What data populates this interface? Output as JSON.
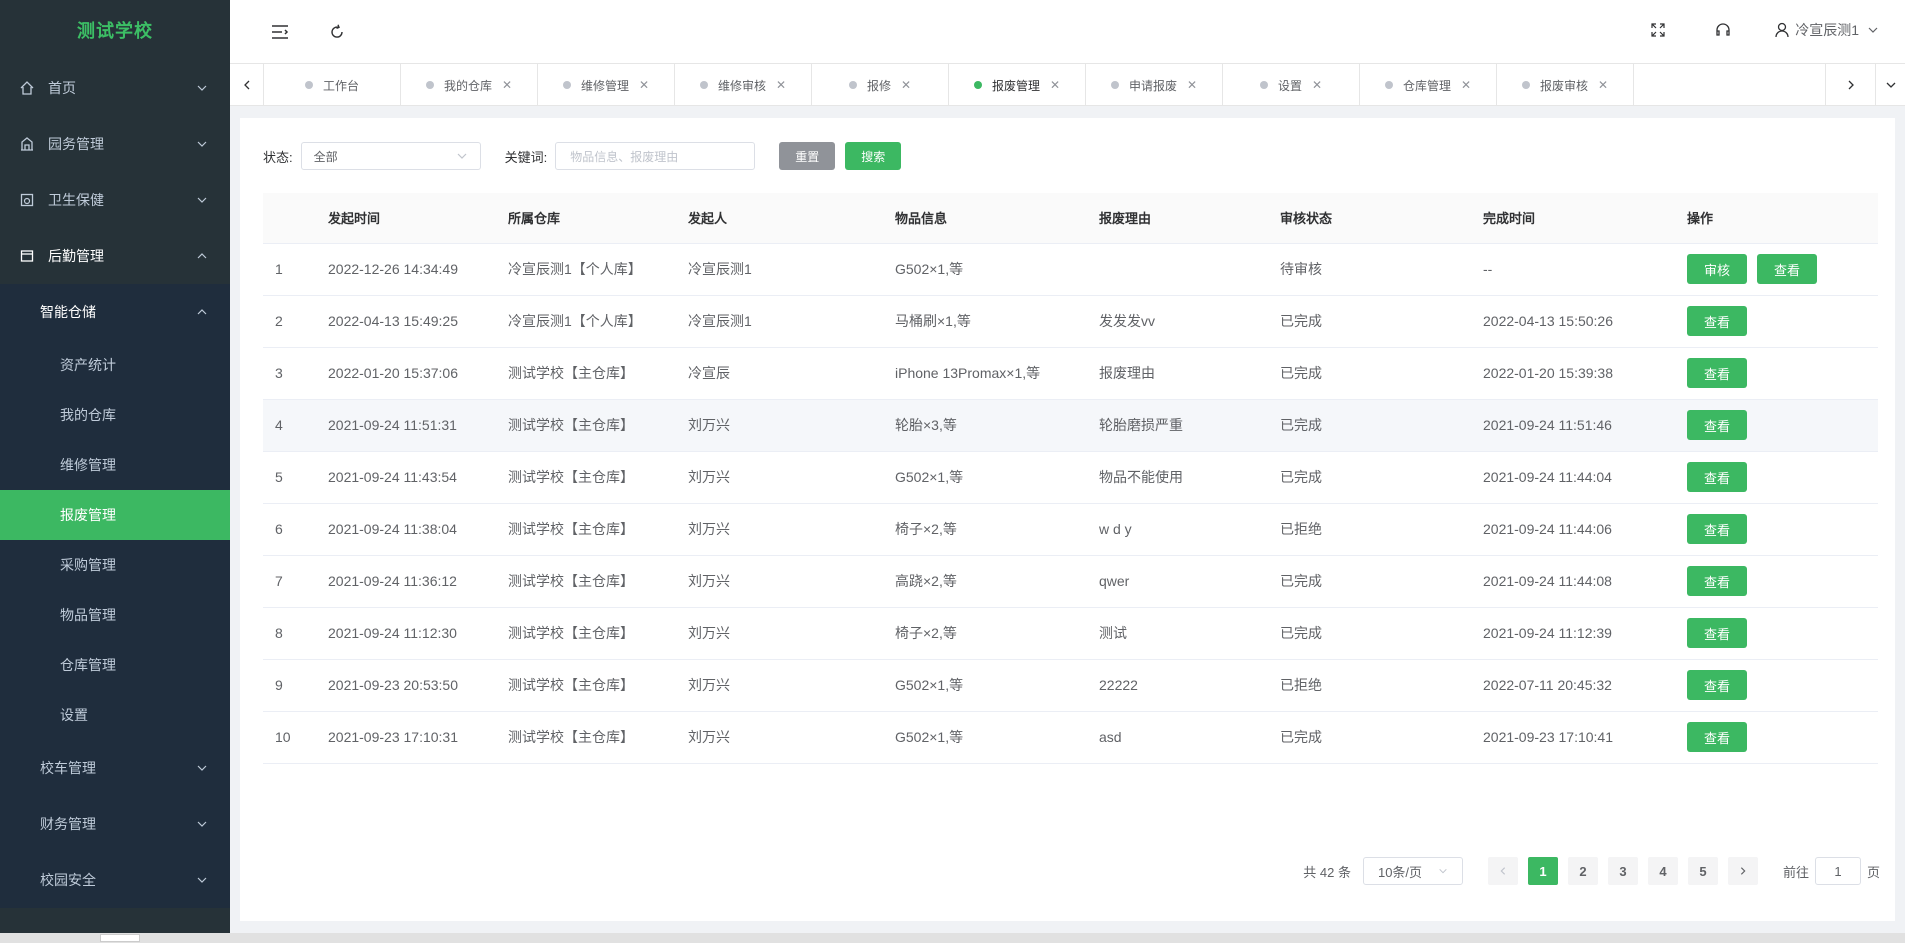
{
  "app": {
    "title": "测试学校"
  },
  "sidebar": {
    "items": [
      {
        "label": "首页",
        "icon": "home-icon"
      },
      {
        "label": "园务管理",
        "icon": "building-icon"
      },
      {
        "label": "卫生保健",
        "icon": "health-icon"
      },
      {
        "label": "后勤管理",
        "icon": "logistics-icon"
      }
    ],
    "submenu_title": "智能仓储",
    "leaves": [
      "资产统计",
      "我的仓库",
      "维修管理",
      "报废管理",
      "采购管理",
      "物品管理",
      "仓库管理",
      "设置"
    ],
    "active_leaf": "报废管理",
    "more": [
      "校车管理",
      "财务管理",
      "校园安全"
    ]
  },
  "header": {
    "user": "冷宣辰测1"
  },
  "tabs": [
    {
      "label": "工作台"
    },
    {
      "label": "我的仓库"
    },
    {
      "label": "维修管理"
    },
    {
      "label": "维修审核"
    },
    {
      "label": "报修"
    },
    {
      "label": "报废管理",
      "active": true
    },
    {
      "label": "申请报废"
    },
    {
      "label": "设置"
    },
    {
      "label": "仓库管理"
    },
    {
      "label": "报废审核"
    }
  ],
  "filters": {
    "status_label": "状态:",
    "status_value": "全部",
    "keyword_label": "关键词:",
    "keyword_placeholder": "物品信息、报废理由",
    "reset": "重置",
    "search": "搜索"
  },
  "table": {
    "headers": [
      "",
      "发起时间",
      "所属仓库",
      "发起人",
      "物品信息",
      "报废理由",
      "审核状态",
      "完成时间",
      "操作"
    ],
    "rows": [
      {
        "idx": "1",
        "time": "2022-12-26 14:34:49",
        "wh": "冷宣辰测1【个人库】",
        "user": "冷宣辰测1",
        "item": "G502×1,等",
        "reason": "",
        "status": "待审核",
        "done": "--",
        "ops": [
          "审核",
          "查看"
        ]
      },
      {
        "idx": "2",
        "time": "2022-04-13 15:49:25",
        "wh": "冷宣辰测1【个人库】",
        "user": "冷宣辰测1",
        "item": "马桶刷×1,等",
        "reason": "发发发vv",
        "status": "已完成",
        "done": "2022-04-13 15:50:26",
        "ops": [
          "查看"
        ]
      },
      {
        "idx": "3",
        "time": "2022-01-20 15:37:06",
        "wh": "测试学校【主仓库】",
        "user": "冷宣辰",
        "item": "iPhone 13Promax×1,等",
        "reason": "报废理由",
        "status": "已完成",
        "done": "2022-01-20 15:39:38",
        "ops": [
          "查看"
        ]
      },
      {
        "idx": "4",
        "time": "2021-09-24 11:51:31",
        "wh": "测试学校【主仓库】",
        "user": "刘万兴",
        "item": "轮胎×3,等",
        "reason": "轮胎磨损严重",
        "status": "已完成",
        "done": "2021-09-24 11:51:46",
        "ops": [
          "查看"
        ]
      },
      {
        "idx": "5",
        "time": "2021-09-24 11:43:54",
        "wh": "测试学校【主仓库】",
        "user": "刘万兴",
        "item": "G502×1,等",
        "reason": "物品不能使用",
        "status": "已完成",
        "done": "2021-09-24 11:44:04",
        "ops": [
          "查看"
        ]
      },
      {
        "idx": "6",
        "time": "2021-09-24 11:38:04",
        "wh": "测试学校【主仓库】",
        "user": "刘万兴",
        "item": "椅子×2,等",
        "reason": "w d y",
        "status": "已拒绝",
        "done": "2021-09-24 11:44:06",
        "ops": [
          "查看"
        ]
      },
      {
        "idx": "7",
        "time": "2021-09-24 11:36:12",
        "wh": "测试学校【主仓库】",
        "user": "刘万兴",
        "item": "高跷×2,等",
        "reason": "qwer",
        "status": "已完成",
        "done": "2021-09-24 11:44:08",
        "ops": [
          "查看"
        ]
      },
      {
        "idx": "8",
        "time": "2021-09-24 11:12:30",
        "wh": "测试学校【主仓库】",
        "user": "刘万兴",
        "item": "椅子×2,等",
        "reason": "测试",
        "status": "已完成",
        "done": "2021-09-24 11:12:39",
        "ops": [
          "查看"
        ]
      },
      {
        "idx": "9",
        "time": "2021-09-23 20:53:50",
        "wh": "测试学校【主仓库】",
        "user": "刘万兴",
        "item": "G502×1,等",
        "reason": "22222",
        "status": "已拒绝",
        "done": "2022-07-11 20:45:32",
        "ops": [
          "查看"
        ]
      },
      {
        "idx": "10",
        "time": "2021-09-23 17:10:31",
        "wh": "测试学校【主仓库】",
        "user": "刘万兴",
        "item": "G502×1,等",
        "reason": "asd",
        "status": "已完成",
        "done": "2021-09-23 17:10:41",
        "ops": [
          "查看"
        ]
      }
    ]
  },
  "pagination": {
    "total": "共 42 条",
    "size": "10条/页",
    "pages": [
      "1",
      "2",
      "3",
      "4",
      "5"
    ],
    "current": "1",
    "goto_label": "前往",
    "goto_value": "1",
    "goto_suffix": "页"
  },
  "colors": {
    "accent": "#3cb862",
    "sidebar_bg": "#263238"
  }
}
